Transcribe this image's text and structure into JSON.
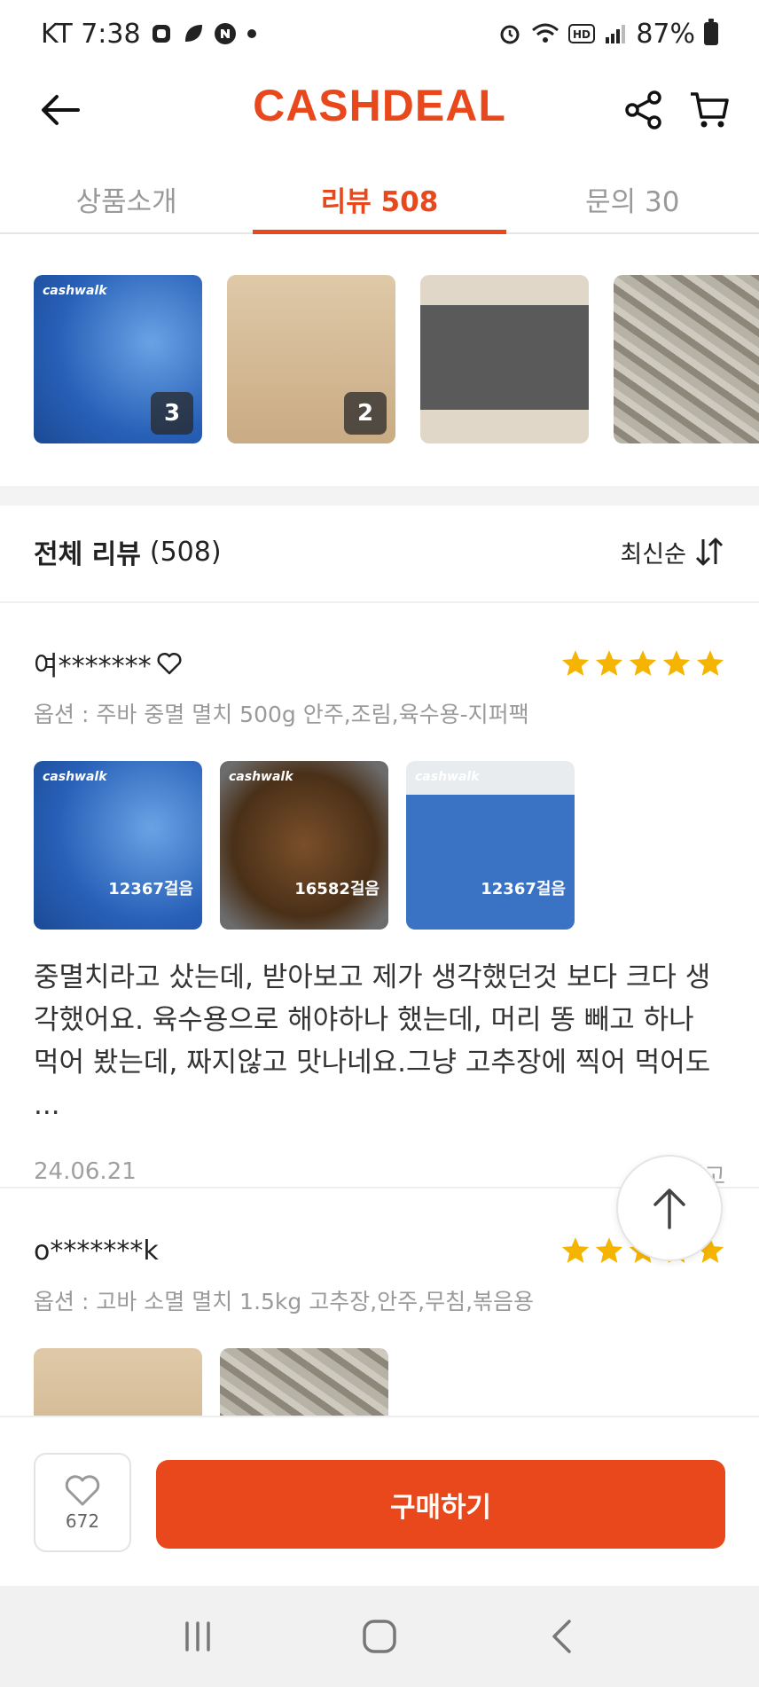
{
  "status_bar": {
    "carrier_time": "KT 7:38",
    "battery": "87%"
  },
  "header": {
    "logo": "CASHDEAL",
    "back_icon": "arrow-left-icon",
    "share_icon": "share-icon",
    "cart_icon": "cart-icon"
  },
  "tabs": [
    {
      "label": "상품소개",
      "active": false
    },
    {
      "label": "리뷰 508",
      "active": true
    },
    {
      "label": "문의 30",
      "active": false
    }
  ],
  "thumbnails": [
    {
      "count": "3"
    },
    {
      "count": "2"
    },
    {
      "count": ""
    },
    {
      "count": ""
    }
  ],
  "reviews_header": {
    "title": "전체 리뷰",
    "count": "(508)",
    "sort_label": "최신순"
  },
  "reviews": [
    {
      "reviewer": "여*******",
      "rating": 5,
      "option": "옵션 : 주바 중멸 멸치 500g 안주,조림,육수용-지퍼팩",
      "images": [
        {
          "steps": "12367걸음"
        },
        {
          "steps": "16582걸음"
        },
        {
          "steps": "12367걸음"
        }
      ],
      "text": "중멸치라고 샀는데, 받아보고 제가 생각했던것 보다 크다 생각했어요. 육수용으로 해야하나 했는데, 머리 똥 빼고 하나 먹어 봤는데, 짜지않고 맛나네요.그냥 고추장에 찍어 먹어도 ...",
      "date": "24.06.21",
      "report": "신고"
    },
    {
      "reviewer": "o*******k",
      "rating": 5,
      "option": "옵션 : 고바 소멸 멸치 1.5kg 고추장,안주,무침,볶음용"
    }
  ],
  "bottom_bar": {
    "wish_count": "672",
    "buy_label": "구매하기"
  },
  "colors": {
    "accent": "#e8481b",
    "star": "#f5b400"
  }
}
